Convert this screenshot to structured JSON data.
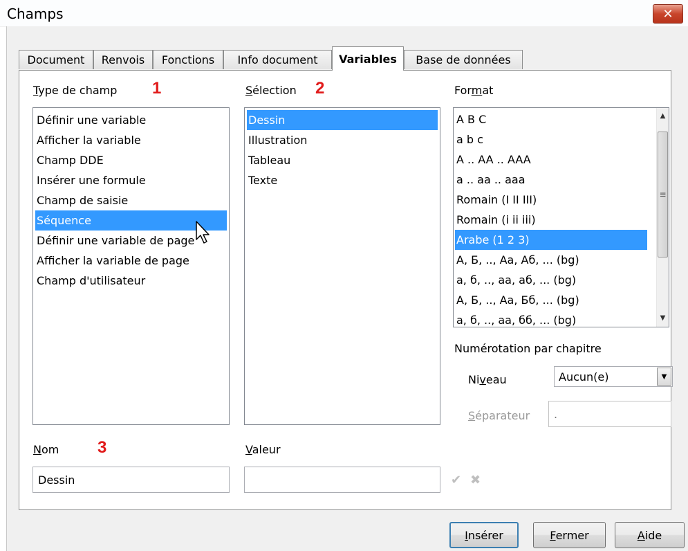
{
  "window": {
    "title": "Champs",
    "close_label": "✕"
  },
  "tabs": [
    {
      "label": "Document"
    },
    {
      "label": "Renvois"
    },
    {
      "label": "Fonctions"
    },
    {
      "label": "Info document"
    },
    {
      "label": "Variables"
    },
    {
      "label": "Base de données"
    }
  ],
  "type_de_champ": {
    "label_first": "T",
    "label_rest": "ype de champ",
    "number": "1",
    "items": [
      "Définir une variable",
      "Afficher la variable",
      "Champ DDE",
      "Insérer une formule",
      "Champ de saisie",
      "Séquence",
      "Définir une variable de page",
      "Afficher la variable de page",
      "Champ d'utilisateur"
    ],
    "selected": "Séquence"
  },
  "selection": {
    "label_first": "S",
    "label_rest": "élection",
    "number": "2",
    "items": [
      "Dessin",
      "Illustration",
      "Tableau",
      "Texte"
    ],
    "selected": "Dessin"
  },
  "format": {
    "label_a": "For",
    "label_u": "m",
    "label_b": "at",
    "items": [
      "A B C",
      "a b c",
      "A .. AA .. AAA",
      "a .. aa .. aaa",
      "Romain (I II III)",
      "Romain (i ii iii)",
      "Arabe (1 2 3)",
      "А, Б, .., Аа, Аб, ... (bg)",
      "а, б, .., аа, аб, ... (bg)",
      "А, Б, .., Аа, Бб, ... (bg)",
      "а, б, .., аа, бб, ... (bg)"
    ],
    "selected": "Arabe (1 2 3)",
    "scroll_up": "▲",
    "scroll_down": "▼",
    "grip": "≡"
  },
  "chapter": {
    "heading": "Numérotation par chapitre",
    "niveau_a": "Ni",
    "niveau_u": "v",
    "niveau_b": "eau",
    "niveau_value": "Aucun(e)",
    "combo_arrow": "▼",
    "separateur_first": "S",
    "separateur_rest": "éparateur",
    "separateur_value": "."
  },
  "nom": {
    "label_first": "N",
    "label_rest": "om",
    "number": "3",
    "value": "Dessin"
  },
  "valeur": {
    "label_first": "V",
    "label_rest": "aleur",
    "value": "",
    "apply_icon": "✔",
    "delete_icon": "✖"
  },
  "buttons": {
    "inserer_first": "I",
    "inserer_rest": "nsérer",
    "fermer_first": "F",
    "fermer_rest": "ermer",
    "aide_first": "A",
    "aide_rest": "ide"
  }
}
